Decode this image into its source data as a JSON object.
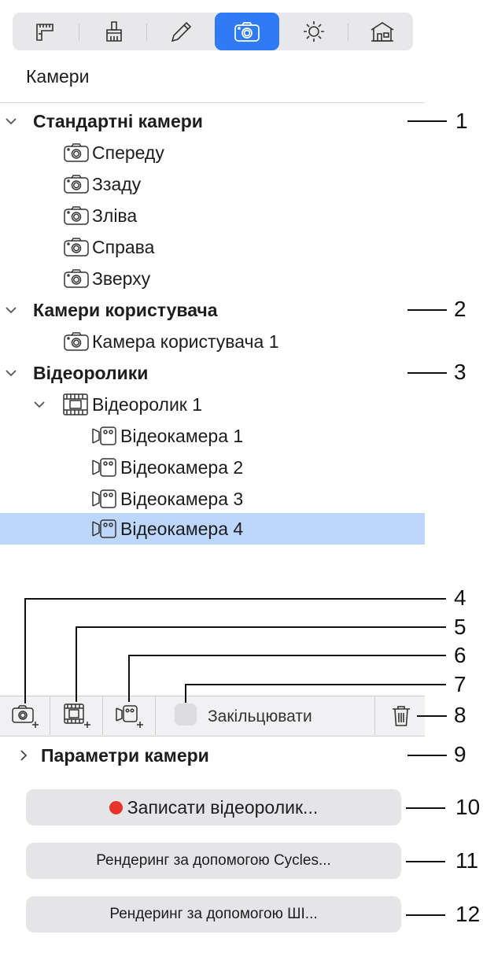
{
  "toolbar": {
    "tabs": [
      {
        "icon": "caliper-ruler-icon"
      },
      {
        "icon": "brush-icon"
      },
      {
        "icon": "pencil-icon"
      },
      {
        "icon": "camera-icon",
        "active": true
      },
      {
        "icon": "sun-icon"
      },
      {
        "icon": "house-icon"
      }
    ],
    "accent": "#2f7bf5"
  },
  "panel_title": "Камери",
  "tree": {
    "standard": {
      "label": "Стандартні камери",
      "items": [
        "Спереду",
        "Ззаду",
        "Зліва",
        "Справа",
        "Зверху"
      ]
    },
    "user": {
      "label": "Камери користувача",
      "items": [
        "Камера користувача 1"
      ]
    },
    "videos": {
      "label": "Відеоролики",
      "clip": {
        "label": "Відеоролик 1",
        "items": [
          "Відеокамера 1",
          "Відеокамера 2",
          "Відеокамера 3",
          "Відеокамера 4"
        ]
      }
    }
  },
  "selection_color": "#bcd7fb",
  "bottom_bar": {
    "loop_label": "Закільцювати",
    "icons": [
      "add-camera-icon",
      "add-clip-icon",
      "add-video-camera-icon",
      "trash-icon"
    ]
  },
  "camera_params": "Параметри камери",
  "buttons": {
    "record": "Записати відеоролик...",
    "record_dot_color": "#e8332a",
    "render_cycles": "Рендеринг за допомогою Cycles...",
    "render_ai": "Рендеринг за допомогою ШІ..."
  },
  "callouts": [
    "1",
    "2",
    "3",
    "4",
    "5",
    "6",
    "7",
    "8",
    "9",
    "10",
    "11",
    "12"
  ]
}
